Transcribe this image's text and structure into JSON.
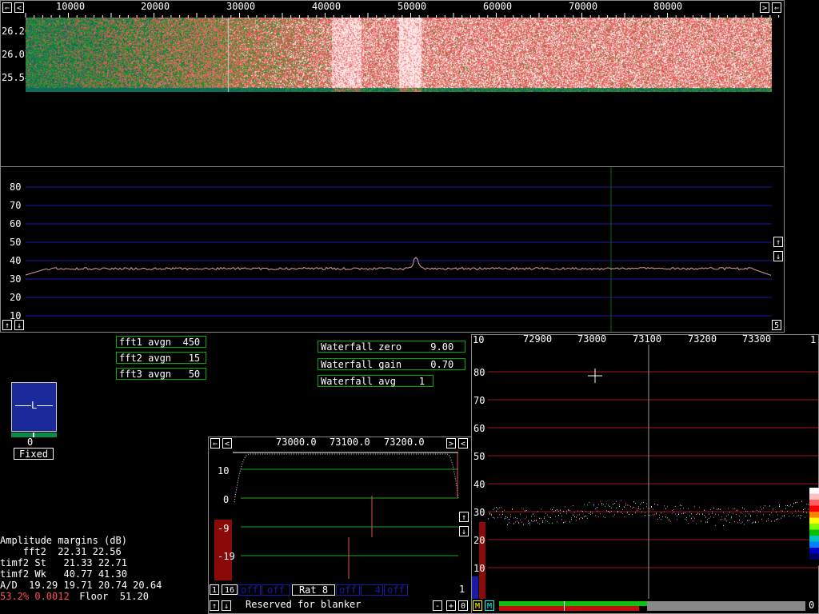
{
  "colors": {
    "grid_blue": "#1a1aa8",
    "grid_green": "#1aa81a",
    "grid_red": "#a01818",
    "cursor_green": "#0a6a0a"
  },
  "waterfall": {
    "freq_ticks": [
      "10000",
      "20000",
      "30000",
      "40000",
      "50000",
      "60000",
      "70000",
      "80000"
    ],
    "time_labels": [
      "26.20",
      "26.07",
      "25.54"
    ]
  },
  "spectrum": {
    "y_ticks": [
      "80",
      "70",
      "60",
      "50",
      "40",
      "30",
      "20",
      "10"
    ],
    "zoom_label": "5",
    "up_icon": "arrow-up-icon",
    "down_icon": "arrow-down-icon"
  },
  "averages": {
    "fft1": "fft1 avgn  450",
    "fft2": "fft2 avgn   15",
    "fft3": "fft3 avgn   50"
  },
  "waterfall_params": {
    "zero": "Waterfall zero     9.00",
    "gain": "Waterfall gain     0.70",
    "avg": "Waterfall avg    1"
  },
  "agc": {
    "letter": "L",
    "value": "0",
    "mode": "Fixed"
  },
  "amplitude": {
    "title": "Amplitude margins (dB)",
    "fft2": "    fft2  22.31 22.56",
    "timf2_st": "timf2 St   21.33 22.71",
    "timf2_wk": "timf2 Wk   40.77 41.30",
    "ad": "A/D  19.29 19.71 20.74 20.64",
    "pct": "53.2% 0.0012",
    "floor": " Floor  51.20"
  },
  "baseband": {
    "freq_ticks": [
      "73000.0",
      "73100.0",
      "73200.0"
    ],
    "y_ticks": [
      "10",
      "0",
      "-9",
      "-19"
    ],
    "bottom": {
      "ch": "1",
      "bw": "16",
      "off1": "off",
      "off2": "off",
      "rat": "Rat  8",
      "off3": "off",
      "four": "4",
      "off4": "off",
      "minus": "-",
      "plus": "+",
      "zero": "0",
      "one": "1"
    },
    "reserved": "Reserved for blanker"
  },
  "hires": {
    "corner_left": "10",
    "corner_right": "1",
    "freq_ticks": [
      "72900",
      "73000",
      "73100",
      "73200",
      "73300"
    ],
    "y_ticks": [
      "80",
      "70",
      "60",
      "50",
      "40",
      "30",
      "20",
      "10"
    ],
    "m1": "M",
    "m2": "M",
    "zero_label": "0"
  }
}
